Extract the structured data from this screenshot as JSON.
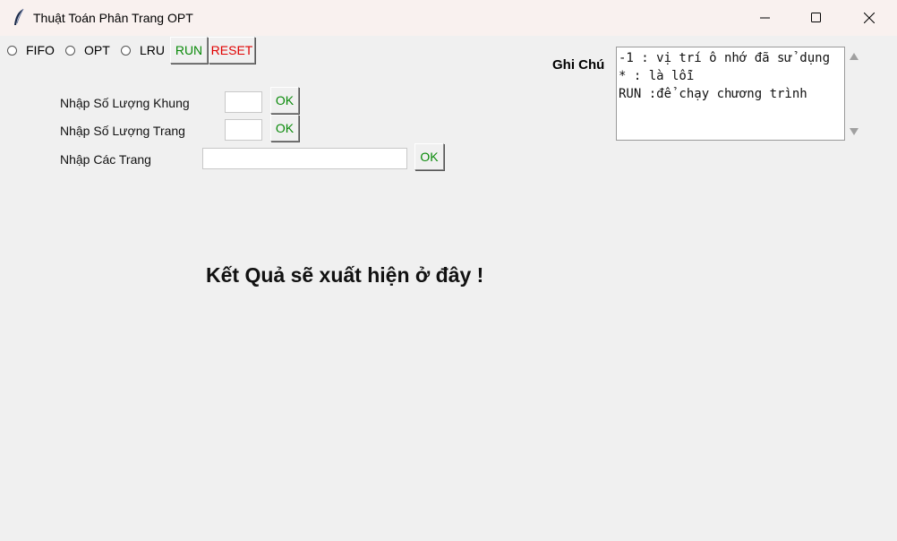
{
  "window": {
    "title": "Thuật Toán Phân Trang OPT"
  },
  "algorithm_options": [
    {
      "label": "FIFO",
      "selected": false
    },
    {
      "label": "OPT",
      "selected": false
    },
    {
      "label": "LRU",
      "selected": false
    }
  ],
  "toolbar": {
    "run_label": "RUN",
    "reset_label": "RESET"
  },
  "form": {
    "frames_label": "Nhập Số Lượng Khung",
    "frames_value": "",
    "pages_count_label": "Nhập Số Lượng Trang",
    "pages_count_value": "",
    "pages_label": "Nhập Các Trang",
    "pages_value": "",
    "ok_label": "OK"
  },
  "notes": {
    "label": "Ghi Chú",
    "text": "-1 : vị trí ô nhớ đã sử dụng\n* : là lỗi\nRUN :để chạy chương trình"
  },
  "result": {
    "text": "Kết Quả sẽ xuất hiện ở đây !"
  },
  "colors": {
    "ok_text": "#0a8a0a",
    "reset_text": "#e00000",
    "titlebar": "#f9f1ef"
  }
}
